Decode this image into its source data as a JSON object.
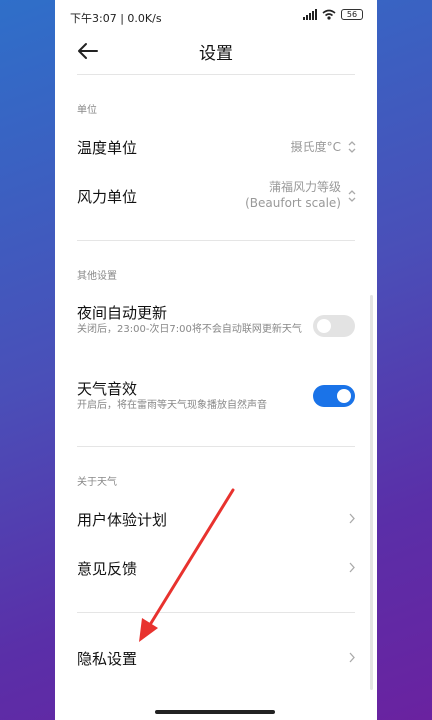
{
  "status_bar": {
    "time": "下午3:07 | 0.0K/s",
    "battery": "56"
  },
  "header": {
    "title": "设置"
  },
  "units_section": {
    "title": "单位",
    "temperature": {
      "label": "温度单位",
      "value": "摄氏度°C"
    },
    "wind": {
      "label": "风力单位",
      "value_line1": "蒲福风力等级",
      "value_line2": "(Beaufort scale)"
    }
  },
  "other_section": {
    "title": "其他设置",
    "night_update": {
      "label": "夜间自动更新",
      "desc": "关闭后，23:00-次日7:00将不会自动联网更新天气",
      "enabled": false
    },
    "weather_sound": {
      "label": "天气音效",
      "desc": "开启后，将在雷雨等天气现象播放自然声音",
      "enabled": true
    }
  },
  "about_section": {
    "title": "关于天气",
    "ux_plan": {
      "label": "用户体验计划"
    },
    "feedback": {
      "label": "意见反馈"
    }
  },
  "privacy": {
    "label": "隐私设置"
  },
  "colors": {
    "toggle_on": "#1a73e8",
    "annotation_arrow": "#e8322e"
  },
  "icons": [
    "back-arrow-icon",
    "updown-icon",
    "chevron-right-icon",
    "signal-icon",
    "wifi-icon",
    "battery-icon"
  ]
}
